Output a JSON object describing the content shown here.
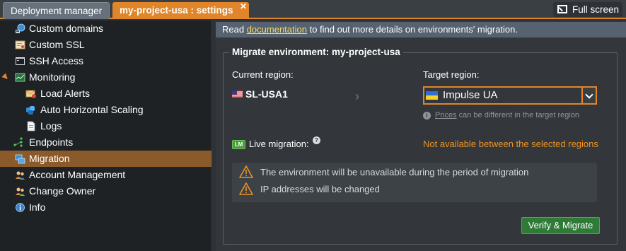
{
  "tabs": {
    "deployment_manager": "Deployment manager",
    "settings": "my-project-usa : settings",
    "close_glyph": "✕",
    "fullscreen": "Full screen"
  },
  "sidebar": {
    "items": [
      {
        "label": "Custom domains",
        "icon": "globe-network-icon"
      },
      {
        "label": "Custom SSL",
        "icon": "certificate-icon"
      },
      {
        "label": "SSH Access",
        "icon": "terminal-icon"
      },
      {
        "label": "Monitoring",
        "icon": "monitoring-icon",
        "expanded": true
      },
      {
        "label": "Load Alerts",
        "icon": "mail-alert-icon"
      },
      {
        "label": "Auto Horizontal Scaling",
        "icon": "scaling-icon"
      },
      {
        "label": "Logs",
        "icon": "document-icon"
      },
      {
        "label": "Endpoints",
        "icon": "endpoints-icon"
      },
      {
        "label": "Migration",
        "icon": "migration-icon",
        "active": true
      },
      {
        "label": "Account Management",
        "icon": "users-icon"
      },
      {
        "label": "Change Owner",
        "icon": "change-owner-icon"
      },
      {
        "label": "Info",
        "icon": "info-icon"
      }
    ]
  },
  "infobar": {
    "before": "Read ",
    "link": "documentation",
    "after": " to find out more details on environments' migration."
  },
  "migrate": {
    "legend": "Migrate environment: my-project-usa",
    "current_region_label": "Current region:",
    "current_region": "SL-USA1",
    "target_region_label": "Target region:",
    "target_region": "Impulse UA",
    "prices_link": "Prices",
    "prices_text": " can be different in the target region",
    "lm_badge": "LM",
    "live_migration_label": "Live migration:",
    "help_glyph": "?",
    "live_migration_status": "Not available between the selected regions",
    "warnings": [
      "The environment will be unavailable during the period of migration",
      "IP addresses will be changed"
    ],
    "verify_button": "Verify & Migrate"
  },
  "colors": {
    "accent": "#e0852a",
    "active_item": "#8a5a2b",
    "warning_text": "#ef9322",
    "button_green": "#2f7a37"
  }
}
